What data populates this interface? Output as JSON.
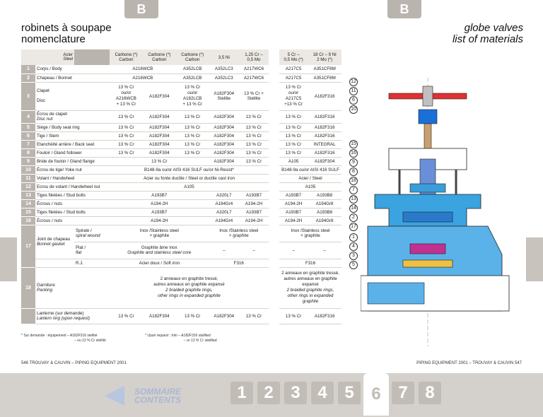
{
  "tabs": {
    "left": "B",
    "right": "B"
  },
  "title_left": [
    "robinets à soupape",
    "nomenclature"
  ],
  "title_right": [
    "globe valves",
    "list of materials"
  ],
  "header": {
    "acier": "Acier",
    "steel": "Steel",
    "cols": [
      "Carbone (*)",
      "Carbone (*)",
      "Carbone (*)",
      "3,5 Ni",
      "1,25 Cr –"
    ],
    "cols2": [
      "Carbon",
      "Carbon",
      "Carbon",
      "",
      "0,5 Mo"
    ],
    "rcols": [
      "5 Cr –",
      "18 Cr – 9 Ni"
    ],
    "rcols2": [
      "0,5 Mo (*)",
      "2 Mo (*)"
    ]
  },
  "rows": [
    {
      "n": "1",
      "d": "Corps / Body"
    },
    {
      "n": "2",
      "d": "Chapeau / Bonnet"
    },
    {
      "n": "3",
      "d": "Clapet"
    },
    {
      "n": "4",
      "d": "Écrou de clapet"
    },
    {
      "n": "5",
      "d": "Siège / Body seat ring"
    },
    {
      "n": "6",
      "d": "Tige / Stem"
    },
    {
      "n": "7",
      "d": "Etanchéité arrière / Back seat"
    },
    {
      "n": "8",
      "d": "Fouloir / Gland follower"
    },
    {
      "n": "9",
      "d": "Bride de fouloir / Gland flange"
    },
    {
      "n": "10",
      "d": "Écrou de tige/ Yoke nut"
    },
    {
      "n": "11",
      "d": "Volant / Handwheel"
    },
    {
      "n": "12",
      "d": "Ecrou de volant / Handwheel nut"
    },
    {
      "n": "13",
      "d": "Tiges filetées / Stud bolts"
    },
    {
      "n": "14",
      "d": "Écrous / nuts"
    },
    {
      "n": "15",
      "d": "Tiges filetées / Stud bolts"
    },
    {
      "n": "16",
      "d": "Écrous / nuts"
    },
    {
      "n": "17",
      "d": "Joint de chapeau"
    },
    {
      "n": "18",
      "d": "Garniture"
    }
  ],
  "disc": "Disc",
  "disc_nut": "Disc nut",
  "bonnet_gasket": "Bonnet gasket",
  "packing": "Packing",
  "lanterne": "Lanterne (sur demande)",
  "lantern": "Lantern ring (upon request)",
  "v": {
    "a216wcb": "A216WCB",
    "a352lcb": "A352LCB",
    "a352lc3": "A352LC3",
    "a217wc6": "A217WC6",
    "a217c5": "A217C5",
    "a351cf8m": "A351CF8M",
    "cr13": "13 % Cr",
    "a182f304": "A182F304",
    "a182f316": "A182F316",
    "integral": "INTEGRAL",
    "a105": "A105",
    "oucr": "ou/or",
    "a216wcb13": "A216WCB",
    "pct13": "+ 13 % Cr",
    "a182lcb": "A182LCB",
    "a182f304st": "A182F304",
    "stellite": "Stellite",
    "cr13plus": "13 % Cr +",
    "a217c5b": "A217C5",
    "p13cr": "+13 % Cr",
    "yoke": "B148-9a  ou/or  AISI 416 SULF  ou/or  Ni-Resist*",
    "yoke_r": "B148-9a ou/or AISI 416 SULF",
    "handwheel": "Acier ou fonte ductile / Steel or ductile cast iron",
    "handwheel_r": "Acier / Steel",
    "a193b7": "A193B7",
    "a320l7": "A320L7",
    "a194_2h": "A194-2H",
    "a194gr4": "A194Gr4",
    "a193b8": "A193B8",
    "a194gr8": "A194Gr8",
    "spirale": "Spirale /",
    "spiral": "spiral wound",
    "inox_ss": "Inox /Stainless steel",
    "graphite": "+ graphite",
    "plat": "Plat /",
    "flat": "flat",
    "graphite_ame": "Graphite âme inox",
    "graphite_ss": "Graphite and stainless steel core",
    "rj": "R.J.",
    "soft_iron": "Acier doux / Soft iron",
    "f316": "F316",
    "dash": "–",
    "packing_text": [
      "2 anneaux en graphite tressé,",
      "autres anneaux en graphite expansé",
      "2 braided graphite rings,",
      "other rings in expanded graphite"
    ],
    "packing_text_r": [
      "2 anneaux en graphite tressé,",
      "autres anneaux en graphite",
      "expansé",
      "2 braided graphite rings,",
      "other rings in expanded",
      "graphite"
    ]
  },
  "footnote_l": [
    "* Sur demande : équipement – A182F316 stellité",
    "– ou 13 % Cr stellité"
  ],
  "footnote_r": [
    "* Upon request : trim – A182F316 stellited",
    "– or 13 % Cr stellited."
  ],
  "footer_left": "546      TROUVAY & CAUVIN  – PIPING EQUIPMENT 2001",
  "footer_right": "PIPING EQUIPMENT 2001 – TROUVAY & CAUVIN      547",
  "sommaire": "SOMMAIRE",
  "contents": "CONTENTS",
  "nav": [
    "1",
    "2",
    "3",
    "4",
    "5",
    "6",
    "7",
    "8"
  ],
  "callouts": [
    "12",
    "11",
    "6",
    "10",
    "15",
    "16",
    "9",
    "8",
    "18",
    "7",
    "13",
    "14",
    "2",
    "17",
    "1",
    "4",
    "3",
    "5"
  ]
}
